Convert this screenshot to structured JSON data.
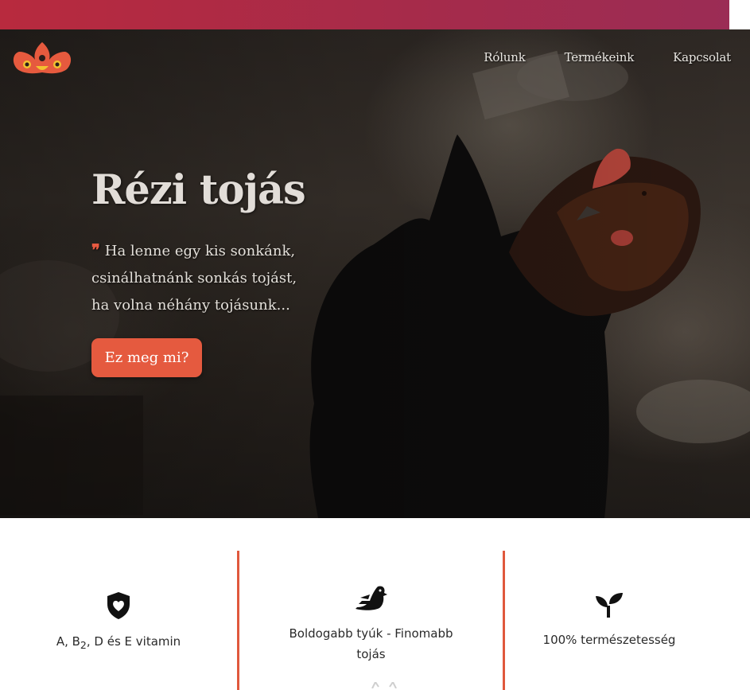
{
  "nav": {
    "items": [
      {
        "label": "Rólunk"
      },
      {
        "label": "Termékeink"
      },
      {
        "label": "Kapcsolat"
      }
    ]
  },
  "hero": {
    "title": "Rézi tojás",
    "quote_mark": "❞",
    "quote_lines": [
      "Ha lenne egy kis sonkánk,",
      "csinálhatnánk sonkás tojást,",
      "ha volna néhány tojásunk..."
    ],
    "cta_label": "Ez meg mi?"
  },
  "features": [
    {
      "icon": "shield-heart-icon",
      "label_prefix": "A, B",
      "label_sub": "2",
      "label_suffix": ", D és E vitamin"
    },
    {
      "icon": "duck-icon",
      "label_lines": [
        "Boldogabb tyúk - Finomabb",
        "tojás"
      ]
    },
    {
      "icon": "sprout-icon",
      "label": "100% természetesség"
    }
  ],
  "colors": {
    "accent": "#e55a3f",
    "top_strip": "#b02b45",
    "divider": "#e0583d"
  }
}
